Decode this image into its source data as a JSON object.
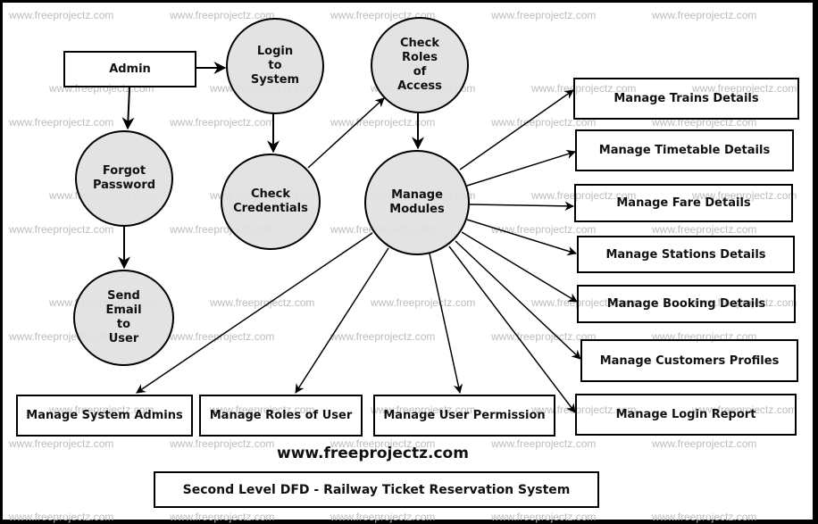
{
  "diagram": {
    "title": "Second Level DFD - Railway Ticket Reservation System",
    "website": "www.freeprojectz.com",
    "watermark": "www.freeprojectz.com",
    "external_entities": {
      "admin": "Admin"
    },
    "processes": {
      "login": "Login\nto\nSystem",
      "check_roles": "Check\nRoles\nof\nAccess",
      "forgot_password": "Forgot\nPassword",
      "check_credentials": "Check\nCredentials",
      "manage_modules": "Manage\nModules",
      "send_email": "Send\nEmail\nto\nUser"
    },
    "modules": {
      "trains": "Manage Trains Details",
      "timetable": "Manage Timetable Details",
      "fare": "Manage Fare Details",
      "stations": "Manage Stations Details",
      "booking": "Manage Booking Details",
      "customers": "Manage Customers Profiles",
      "login_report": "Manage Login Report",
      "system_admins": "Manage System Admins",
      "roles": "Manage Roles of User",
      "permission": "Manage User Permission"
    },
    "flows": [
      {
        "from": "Admin",
        "to": "Login to System"
      },
      {
        "from": "Admin",
        "to": "Forgot Password"
      },
      {
        "from": "Forgot Password",
        "to": "Send Email to User"
      },
      {
        "from": "Login to System",
        "to": "Check Credentials"
      },
      {
        "from": "Check Credentials",
        "to": "Check Roles of Access"
      },
      {
        "from": "Check Roles of Access",
        "to": "Manage Modules"
      },
      {
        "from": "Manage Modules",
        "to": "Manage Trains Details"
      },
      {
        "from": "Manage Modules",
        "to": "Manage Timetable Details"
      },
      {
        "from": "Manage Modules",
        "to": "Manage Fare Details"
      },
      {
        "from": "Manage Modules",
        "to": "Manage Stations Details"
      },
      {
        "from": "Manage Modules",
        "to": "Manage Booking Details"
      },
      {
        "from": "Manage Modules",
        "to": "Manage Customers Profiles"
      },
      {
        "from": "Manage Modules",
        "to": "Manage Login Report"
      },
      {
        "from": "Manage Modules",
        "to": "Manage System Admins"
      },
      {
        "from": "Manage Modules",
        "to": "Manage Roles of User"
      },
      {
        "from": "Manage Modules",
        "to": "Manage User Permission"
      }
    ]
  }
}
